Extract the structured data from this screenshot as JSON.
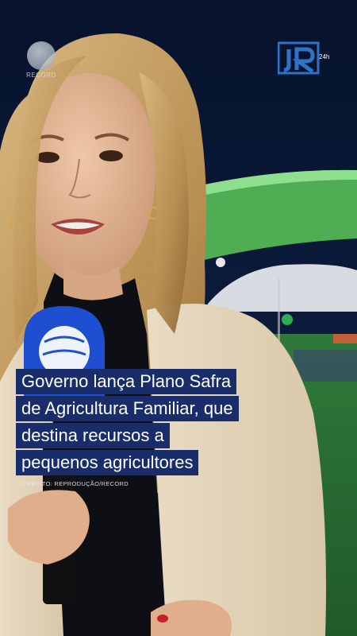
{
  "channel_logo": {
    "label": "RECORD"
  },
  "news_logo": {
    "label": "JR",
    "suffix": "24h"
  },
  "headline": {
    "lines": [
      "Governo lança Plano Safra",
      "de Agricultura Familiar, que",
      "destina recursos a",
      "pequenos agricultores"
    ]
  },
  "credit": "CRÉDITO: REPRODUÇÃO/RECORD",
  "colors": {
    "caption_bg": "#1a2d6b",
    "jr_blue": "#2f73c9",
    "microphone": "#1f4fd1"
  }
}
